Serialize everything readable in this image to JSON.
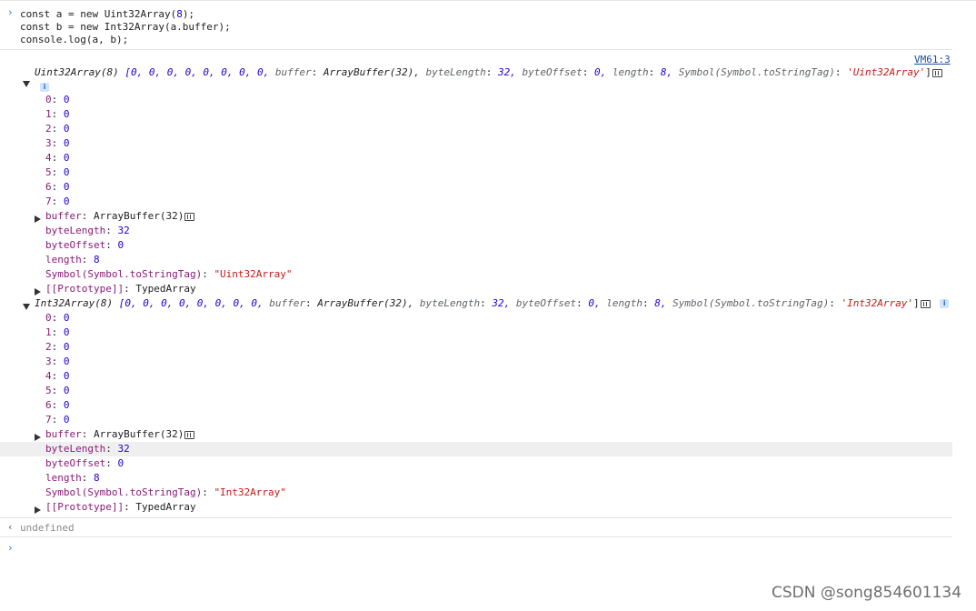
{
  "input_code": {
    "line1": {
      "pre": "const a = new Uint32Array(",
      "num": "8",
      "post": ");"
    },
    "line2": "const b = new Int32Array(a.buffer);",
    "line3": "console.log(a, b);"
  },
  "source_link": "VM61:3",
  "log_a": {
    "summary": {
      "type": "Uint32Array(8)",
      "values": "[0, 0, 0, 0, 0, 0, 0, 0,",
      "buffer_key": "buffer",
      "buffer_val": "ArrayBuffer(32),",
      "bytelength_key": "byteLength",
      "bytelength_val": "32,",
      "byteoffset_key": "byteOffset",
      "byteoffset_val": "0,",
      "length_key": "length",
      "length_val": "8,",
      "tag_key": "Symbol(Symbol.toStringTag)",
      "tag_val": "'Uint32Array'",
      "close": "]"
    },
    "info_label": "i",
    "entries": [
      {
        "k": "0",
        "v": "0"
      },
      {
        "k": "1",
        "v": "0"
      },
      {
        "k": "2",
        "v": "0"
      },
      {
        "k": "3",
        "v": "0"
      },
      {
        "k": "4",
        "v": "0"
      },
      {
        "k": "5",
        "v": "0"
      },
      {
        "k": "6",
        "v": "0"
      },
      {
        "k": "7",
        "v": "0"
      }
    ],
    "props": {
      "buffer_key": "buffer",
      "buffer_val": "ArrayBuffer(32)",
      "bytelength_key": "byteLength",
      "bytelength_val": "32",
      "byteoffset_key": "byteOffset",
      "byteoffset_val": "0",
      "length_key": "length",
      "length_val": "8",
      "tag_key": "Symbol(Symbol.toStringTag)",
      "tag_val": "\"Uint32Array\"",
      "proto_key": "[[Prototype]]",
      "proto_val": "TypedArray"
    }
  },
  "log_b": {
    "summary": {
      "type": "Int32Array(8)",
      "values": "[0, 0, 0, 0, 0, 0, 0, 0,",
      "buffer_key": "buffer",
      "buffer_val": "ArrayBuffer(32),",
      "bytelength_key": "byteLength",
      "bytelength_val": "32,",
      "byteoffset_key": "byteOffset",
      "byteoffset_val": "0,",
      "length_key": "length",
      "length_val": "8,",
      "tag_key": "Symbol(Symbol.toStringTag)",
      "tag_val": "'Int32Array'",
      "close": "]"
    },
    "info_label": "i",
    "entries": [
      {
        "k": "0",
        "v": "0"
      },
      {
        "k": "1",
        "v": "0"
      },
      {
        "k": "2",
        "v": "0"
      },
      {
        "k": "3",
        "v": "0"
      },
      {
        "k": "4",
        "v": "0"
      },
      {
        "k": "5",
        "v": "0"
      },
      {
        "k": "6",
        "v": "0"
      },
      {
        "k": "7",
        "v": "0"
      }
    ],
    "props": {
      "buffer_key": "buffer",
      "buffer_val": "ArrayBuffer(32)",
      "bytelength_key": "byteLength",
      "bytelength_val": "32",
      "byteoffset_key": "byteOffset",
      "byteoffset_val": "0",
      "length_key": "length",
      "length_val": "8",
      "tag_key": "Symbol(Symbol.toStringTag)",
      "tag_val": "\"Int32Array\"",
      "proto_key": "[[Prototype]]",
      "proto_val": "TypedArray"
    }
  },
  "result": "undefined",
  "prompts": {
    "input": "›",
    "result": "‹",
    "cursor": "›"
  },
  "watermark": "CSDN @song854601134",
  "icons": {
    "expand": "triangle-down-icon",
    "collapse": "triangle-right-icon",
    "info": "info-icon",
    "memory": "memory-inspector-icon"
  },
  "colors": {
    "key": "#8a1b77",
    "number": "#1c00cf",
    "string": "#c41a16",
    "link": "#1a4fa0",
    "prompt": "#1a73e8"
  }
}
